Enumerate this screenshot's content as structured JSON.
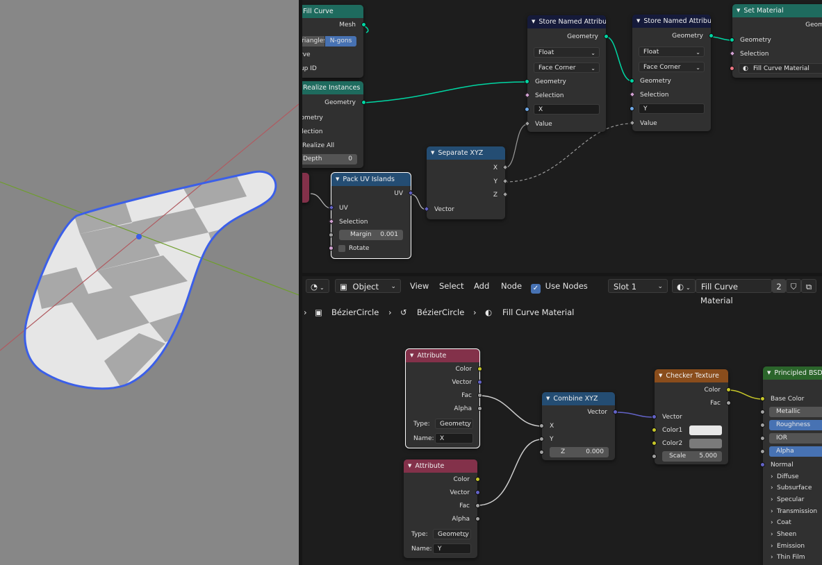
{
  "geometry_nodes": {
    "fill_curve": {
      "title": "Fill Curve",
      "out_mesh": "Mesh",
      "mode_left": "Triangles",
      "mode_right": "N-gons",
      "in_curve": "Curve",
      "in_group": "Group ID"
    },
    "realize": {
      "title": "Realize Instances",
      "out_geometry": "Geometry",
      "in_geometry": "Geometry",
      "in_selection": "Selection",
      "realize_all": "Realize All",
      "depth_label": "Depth",
      "depth_value": "0"
    },
    "pack_uv": {
      "title": "Pack UV Islands",
      "out_uv": "UV",
      "in_uv": "UV",
      "in_selection": "Selection",
      "margin_label": "Margin",
      "margin_value": "0.001",
      "rotate": "Rotate"
    },
    "sep_xyz": {
      "title": "Separate XYZ",
      "out_x": "X",
      "out_y": "Y",
      "out_z": "Z",
      "in_vector": "Vector"
    },
    "store1": {
      "title": "Store Named Attribute",
      "out_geometry": "Geometry",
      "type": "Float",
      "domain": "Face Corner",
      "in_geometry": "Geometry",
      "in_selection": "Selection",
      "name": "X",
      "in_value": "Value"
    },
    "store2": {
      "title": "Store Named Attribute",
      "out_geometry": "Geometry",
      "type": "Float",
      "domain": "Face Corner",
      "in_geometry": "Geometry",
      "in_selection": "Selection",
      "name": "Y",
      "in_value": "Value"
    },
    "set_material": {
      "title": "Set Material",
      "out_geometry": "Geometry",
      "in_geometry": "Geometry",
      "in_selection": "Selection",
      "material": "Fill Curve Material"
    }
  },
  "shader_header": {
    "editor_type_icon": "shader-editor-icon",
    "mode": "Object",
    "menus": [
      "View",
      "Select",
      "Add",
      "Node"
    ],
    "use_nodes_label": "Use Nodes",
    "use_nodes_checked": true,
    "slot": "Slot 1",
    "material": "Fill Curve Material",
    "users": "2"
  },
  "breadcrumbs": {
    "object": "BézierCircle",
    "data": "BézierCircle",
    "material": "Fill Curve Material"
  },
  "shader_nodes": {
    "attr1": {
      "title": "Attribute",
      "out_color": "Color",
      "out_vector": "Vector",
      "out_fac": "Fac",
      "out_alpha": "Alpha",
      "type_label": "Type:",
      "type_value": "Geometry",
      "name_label": "Name:",
      "name_value": "X"
    },
    "attr2": {
      "title": "Attribute",
      "out_color": "Color",
      "out_vector": "Vector",
      "out_fac": "Fac",
      "out_alpha": "Alpha",
      "type_label": "Type:",
      "type_value": "Geometry",
      "name_label": "Name:",
      "name_value": "Y"
    },
    "combine": {
      "title": "Combine XYZ",
      "out_vector": "Vector",
      "in_x": "X",
      "in_y": "Y",
      "z_label": "Z",
      "z_value": "0.000"
    },
    "checker": {
      "title": "Checker Texture",
      "out_color": "Color",
      "out_fac": "Fac",
      "in_vector": "Vector",
      "color1": "Color1",
      "color2": "Color2",
      "scale_label": "Scale",
      "scale_value": "5.000",
      "color1_hex": "#e8e8e8",
      "color2_hex": "#7a7a7a"
    },
    "bsdf": {
      "title": "Principled BSDF",
      "base_color": "Base Color",
      "metallic": "Metallic",
      "roughness": "Roughness",
      "ior": "IOR",
      "alpha": "Alpha",
      "normal": "Normal",
      "panels": [
        "Diffuse",
        "Subsurface",
        "Specular",
        "Transmission",
        "Coat",
        "Sheen",
        "Emission",
        "Thin Film"
      ]
    }
  },
  "colors": {
    "geometry": "#00d6a3",
    "vector": "#6363c7",
    "color": "#c7c729",
    "float": "#a1a1a1",
    "selection_outline": "#4772ff"
  }
}
